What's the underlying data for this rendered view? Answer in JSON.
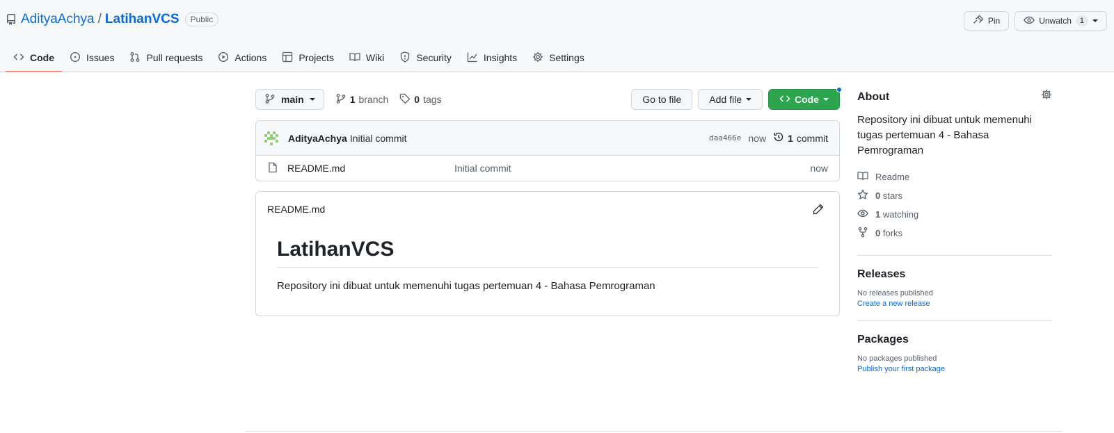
{
  "header": {
    "owner": "AdityaAchya",
    "separator": "/",
    "repo": "LatihanVCS",
    "visibility": "Public",
    "pin_label": "Pin",
    "unwatch_label": "Unwatch",
    "watch_count": "1"
  },
  "tabs": [
    {
      "label": "Code",
      "icon": "code-icon",
      "active": true
    },
    {
      "label": "Issues",
      "icon": "issue-icon"
    },
    {
      "label": "Pull requests",
      "icon": "pull-request-icon"
    },
    {
      "label": "Actions",
      "icon": "play-icon"
    },
    {
      "label": "Projects",
      "icon": "table-icon"
    },
    {
      "label": "Wiki",
      "icon": "book-icon"
    },
    {
      "label": "Security",
      "icon": "shield-icon"
    },
    {
      "label": "Insights",
      "icon": "graph-icon"
    },
    {
      "label": "Settings",
      "icon": "gear-icon"
    }
  ],
  "toolbar": {
    "branch": "main",
    "branch_count": "1",
    "branch_label": "branch",
    "tag_count": "0",
    "tag_label": "tags",
    "goto_file": "Go to file",
    "add_file": "Add file",
    "code": "Code"
  },
  "commit": {
    "author": "AdityaAchya",
    "message": "Initial commit",
    "sha": "daa466e",
    "time": "now",
    "count": "1",
    "count_label": "commit"
  },
  "files": [
    {
      "name": "README.md",
      "message": "Initial commit",
      "time": "now"
    }
  ],
  "readme": {
    "filename": "README.md",
    "heading": "LatihanVCS",
    "paragraph": "Repository ini dibuat untuk memenuhi tugas pertemuan 4 - Bahasa Pemrograman"
  },
  "about": {
    "title": "About",
    "description": "Repository ini dibuat untuk memenuhi tugas pertemuan 4 - Bahasa Pemrograman",
    "readme": "Readme",
    "stars_count": "0",
    "stars_label": "stars",
    "watching_count": "1",
    "watching_label": "watching",
    "forks_count": "0",
    "forks_label": "forks"
  },
  "releases": {
    "title": "Releases",
    "empty": "No releases published",
    "link": "Create a new release"
  },
  "packages": {
    "title": "Packages",
    "empty": "No packages published",
    "link": "Publish your first package"
  },
  "colors": {
    "accent_blue": "#0969da",
    "code_button_green": "#2da44e",
    "active_tab_underline": "#fd8c73"
  }
}
